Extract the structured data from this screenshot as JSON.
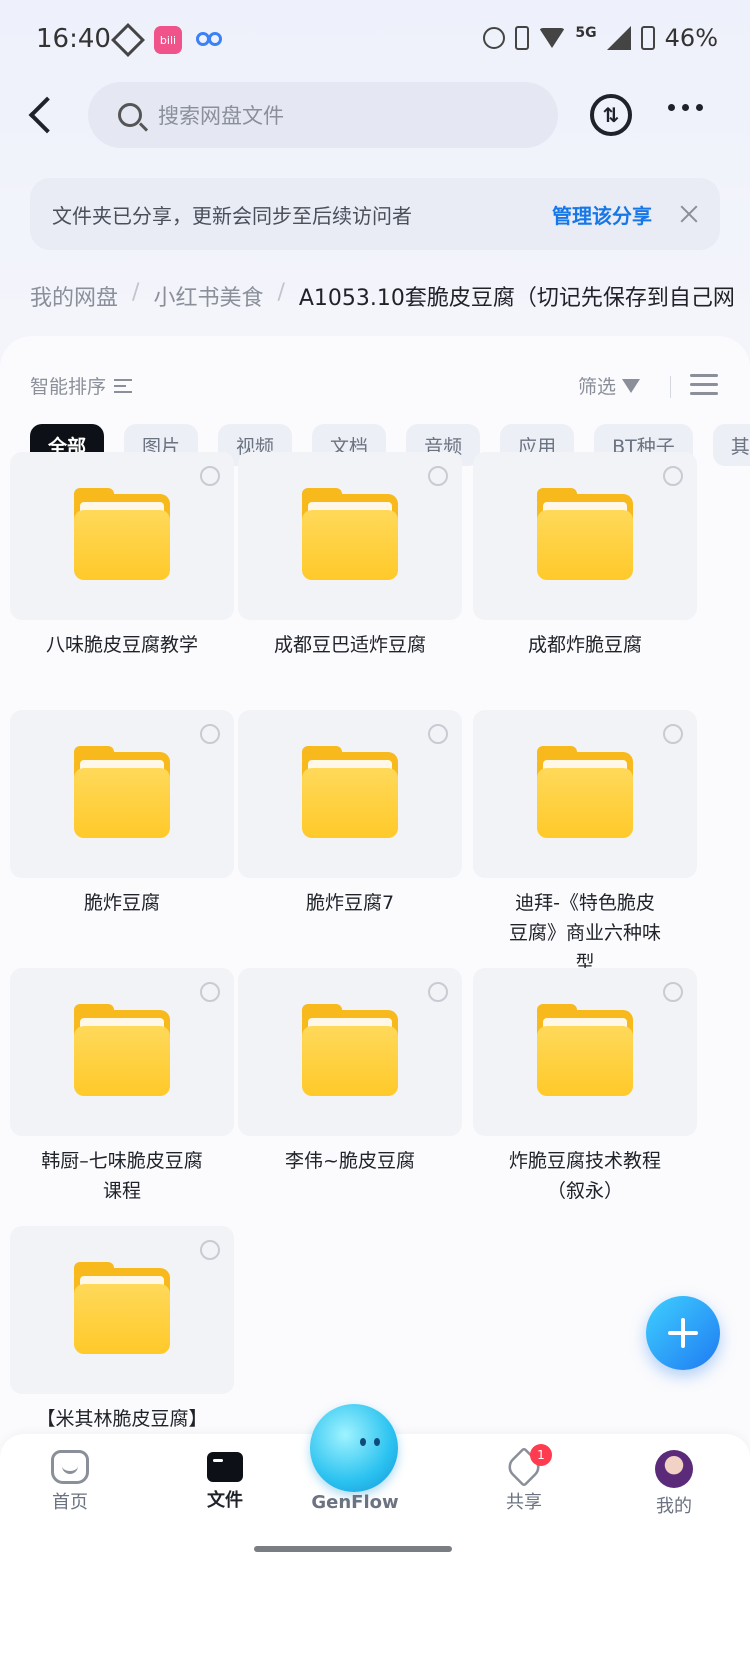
{
  "status_bar": {
    "time": "16:40",
    "app1_text": "bili",
    "network": "5G",
    "battery": "46%"
  },
  "header": {
    "search_placeholder": "搜索网盘文件"
  },
  "share_banner": {
    "message": "文件夹已分享，更新会同步至后续访问者",
    "link": "管理该分享"
  },
  "breadcrumb": {
    "items": [
      "我的网盘",
      "小红书美食",
      "A1053.10套脆皮豆腐（切记先保存到自己网"
    ],
    "separator": "/"
  },
  "toolbar": {
    "sort_label": "智能排序",
    "filter_label": "筛选"
  },
  "chips": [
    "全部",
    "图片",
    "视频",
    "文档",
    "音频",
    "应用",
    "BT种子",
    "其"
  ],
  "folders": [
    {
      "name": "八味脆皮豆腐教学"
    },
    {
      "name": "成都豆巴适炸豆腐"
    },
    {
      "name": "成都炸脆豆腐"
    },
    {
      "name": "脆炸豆腐"
    },
    {
      "name": "脆炸豆腐7"
    },
    {
      "name": "迪拜-《特色脆皮豆腐》商业六种味型"
    },
    {
      "name": "韩厨–七味脆皮豆腐课程"
    },
    {
      "name": "李伟~脆皮豆腐"
    },
    {
      "name": "炸脆豆腐技术教程（叙永）"
    },
    {
      "name": "【米其林脆皮豆腐】"
    }
  ],
  "bottom_nav": {
    "home": "首页",
    "files": "文件",
    "genflow": "GenFlow",
    "share": "共享",
    "share_badge": "1",
    "mine": "我的"
  },
  "colors": {
    "accent": "#1677e8",
    "folder": "#ffc929",
    "active_chip": "#0d1117",
    "badge": "#ff3b4f"
  }
}
